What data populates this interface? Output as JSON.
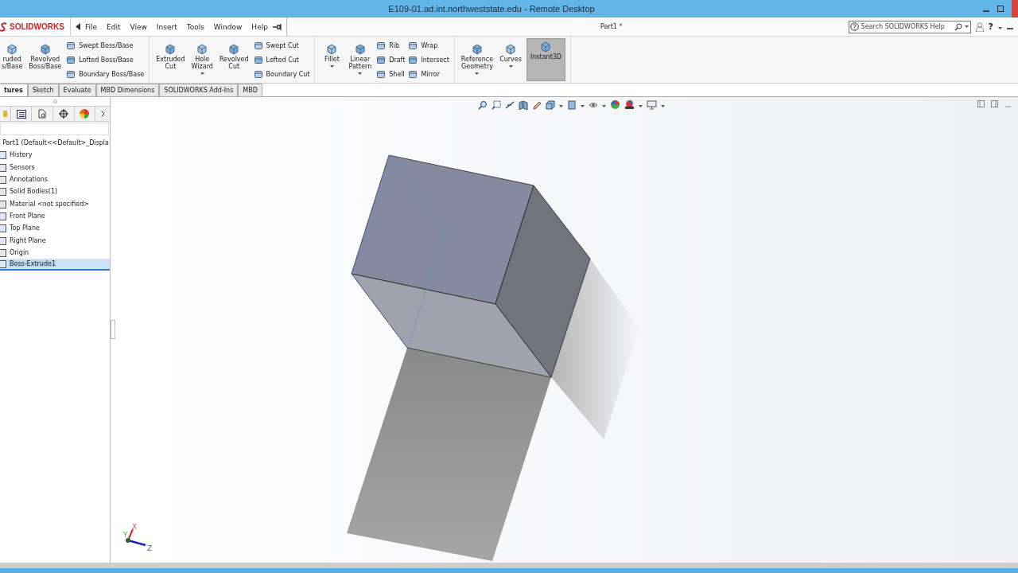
{
  "window": {
    "title": "E109-01.ad.int.northweststate.edu - Remote Desktop"
  },
  "app": {
    "logo": "SOLIDWORKS",
    "menus": [
      "File",
      "Edit",
      "View",
      "Insert",
      "Tools",
      "Window",
      "Help"
    ],
    "document": "Part1 *",
    "search": {
      "placeholder": "Search SOLIDWORKS Help"
    },
    "help": "?"
  },
  "ribbon": [
    {
      "large": [
        {
          "lines": [
            "ruded",
            "s/Base"
          ],
          "dropdown": false,
          "pressed": false
        },
        {
          "lines": [
            "Revolved",
            "Boss/Base"
          ],
          "dropdown": false,
          "pressed": false
        }
      ],
      "small": [
        [
          "Swept Boss/Base",
          "Lofted Boss/Base",
          "Boundary Boss/Base"
        ]
      ]
    },
    {
      "large": [
        {
          "lines": [
            "Extruded",
            "Cut"
          ],
          "dropdown": false,
          "pressed": false
        },
        {
          "lines": [
            "Hole",
            "Wizard"
          ],
          "dropdown": true,
          "pressed": false
        },
        {
          "lines": [
            "Revolved",
            "Cut"
          ],
          "dropdown": false,
          "pressed": false
        }
      ],
      "small": [
        [
          "Swept Cut",
          "Lofted Cut",
          "Boundary Cut"
        ]
      ]
    },
    {
      "large": [
        {
          "lines": [
            "Fillet"
          ],
          "dropdown": true,
          "pressed": false
        },
        {
          "lines": [
            "Linear",
            "Pattern"
          ],
          "dropdown": true,
          "pressed": false
        }
      ],
      "small": [
        [
          "Rib",
          "Draft",
          "Shell"
        ],
        [
          "Wrap",
          "Intersect",
          "Mirror"
        ]
      ]
    },
    {
      "large": [
        {
          "lines": [
            "Reference",
            "Geometry"
          ],
          "dropdown": true,
          "pressed": false
        },
        {
          "lines": [
            "Curves"
          ],
          "dropdown": true,
          "pressed": false
        },
        {
          "lines": [
            "Instant3D"
          ],
          "dropdown": false,
          "pressed": true
        }
      ]
    }
  ],
  "tabs": [
    {
      "label": "tures",
      "selected": true
    },
    {
      "label": "Sketch",
      "selected": false
    },
    {
      "label": "Evaluate",
      "selected": false
    },
    {
      "label": "MBD Dimensions",
      "selected": false
    },
    {
      "label": "SOLIDWORKS Add-Ins",
      "selected": false
    },
    {
      "label": "MBD",
      "selected": false
    }
  ],
  "tree": [
    {
      "label": "Part1  (Default<<Default>_Displa",
      "selected": false
    },
    {
      "label": "History",
      "selected": false
    },
    {
      "label": "Sensors",
      "selected": false
    },
    {
      "label": "Annotations",
      "selected": false
    },
    {
      "label": "Solid Bodies(1)",
      "selected": false
    },
    {
      "label": "Material <not specified>",
      "selected": false
    },
    {
      "label": "Front Plane",
      "selected": false
    },
    {
      "label": "Top Plane",
      "selected": false
    },
    {
      "label": "Right Plane",
      "selected": false
    },
    {
      "label": "Origin",
      "selected": false
    },
    {
      "label": "Boss-Extrude1",
      "selected": true
    }
  ],
  "triad": {
    "x": "X",
    "y": "Y",
    "z": "Z"
  }
}
